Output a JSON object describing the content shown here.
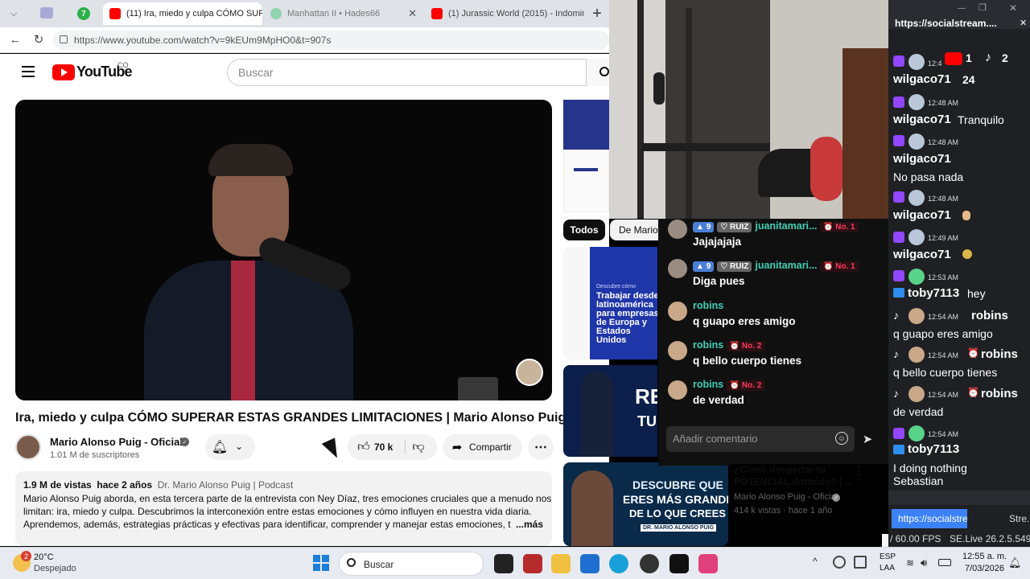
{
  "browser": {
    "tabs": [
      {
        "label": "(11) Ira, miedo y culpa CÓMO SUP",
        "active": true
      },
      {
        "label": "Manhattan II • Hades66",
        "active": false
      },
      {
        "label": "(1) Jurassic World (2015) - Indomin",
        "active": false
      }
    ],
    "pinned_badge": "7",
    "new_tab": "+",
    "url": "https://www.youtube.com/watch?v=9kEUm9MpHO0&t=907s"
  },
  "youtube": {
    "logo": "YouTube",
    "country": "CO",
    "search_placeholder": "Buscar",
    "video_title": "Ira, miedo y culpa CÓMO SUPERAR ESTAS GRANDES LIMITACIONES | Mario Alonso Puig",
    "channel": "Mario Alonso Puig - Oficial",
    "subscribers": "1.01 M de suscriptores",
    "likes": "70 k",
    "share": "Compartir",
    "views": "1.9 M de vistas",
    "age": "hace 2 años",
    "tags": "Dr. Mario Alonso Puig | Podcast",
    "description_line1": "Mario Alonso Puig aborda, en esta tercera parte de la entrevista con Ney Díaz, tres emociones cruciales que a menudo nos",
    "description_line2": "limitan: ira, miedo y culpa. Descubrimos la interconexión entre estas emociones y cómo influyen en nuestra vida diaria.",
    "description_line3": "Aprendemos, además, estrategias prácticas y efectivas para identificar, comprender y manejar estas emociones, trans",
    "more": "...más",
    "chip_all": "Todos",
    "chip_mario": "De Mario",
    "ad_text": "Descubre cómo",
    "ad_title": "Trabajar desde latinoamérica para empresas de Europa y Estados Unidos",
    "thumb_text1": "RE",
    "thumb_text2": "TU",
    "thumb3_line1": "DESCUBRE QUE",
    "thumb3_line2": "ERES MÁS GRANDE",
    "thumb3_line3": "DE LO QUE CREES",
    "thumb3_caption": "DR. MARIO ALONSO PUIG",
    "rec_title": "¿Cómo despertar tu POTENCIAL dormido? | ...",
    "rec_channel": "Mario Alonso Puig - Oficial",
    "rec_meta": "414 k vistas · hace 1 año"
  },
  "tiktok_chat": {
    "messages": [
      {
        "user": "juanitamari...",
        "level": "9",
        "fan": "RUIZ",
        "rank": "No. 1",
        "text": "Jajajajaja"
      },
      {
        "user": "juanitamari...",
        "level": "9",
        "fan": "RUIZ",
        "rank": "No. 1",
        "text": "Diga pues"
      },
      {
        "user": "robins",
        "level": "",
        "fan": "",
        "rank": "",
        "text": "q guapo eres amigo"
      },
      {
        "user": "robins",
        "level": "",
        "fan": "",
        "rank": "No. 2",
        "text": "q bello cuerpo tienes"
      },
      {
        "user": "robins",
        "level": "",
        "fan": "",
        "rank": "No. 2",
        "text": "de verdad"
      }
    ],
    "input_placeholder": "Añadir comentario"
  },
  "side_panel": {
    "title": "https://socialstream....",
    "yt_count": "1",
    "tt_count": "2",
    "messages": [
      {
        "time": "12:4",
        "user": "wilgaco71",
        "text": "24",
        "inline": true
      },
      {
        "time": "12:48 AM",
        "user": "wilgaco71",
        "text": "Tranquilo",
        "inline": true
      },
      {
        "time": "12:48 AM",
        "user": "wilgaco71",
        "text": "No pasa nada",
        "inline": false
      },
      {
        "time": "12:48 AM",
        "user": "wilgaco71",
        "text": "",
        "inline": true
      },
      {
        "time": "12:49 AM",
        "user": "wilgaco71",
        "text": "",
        "inline": true
      },
      {
        "time": "12:53 AM",
        "user": "toby7113",
        "text": "hey",
        "inline": true
      },
      {
        "time": "12:54 AM",
        "user": "robins",
        "text": "q guapo eres amigo",
        "inline": false
      },
      {
        "time": "12:54 AM",
        "user": "robins",
        "text": "q bello cuerpo tienes",
        "inline": false
      },
      {
        "time": "12:54 AM",
        "user": "robins",
        "text": "de verdad",
        "inline": false
      },
      {
        "time": "12:54 AM",
        "user": "toby7113",
        "text": "I doing nothing Sebastian",
        "inline": false
      }
    ],
    "tab1": "https://socialstrea...",
    "tab2": "Stre...",
    "fps": "/ 60.00 FPS",
    "app": "SE.Live 26.2.5.549"
  },
  "taskbar": {
    "weather_badge": "2",
    "temp": "20°C",
    "weather": "Despejado",
    "search": "Buscar",
    "lang1": "ESP",
    "lang2": "LAA",
    "time": "12:55 a. m.",
    "date": "7/03/2026"
  }
}
